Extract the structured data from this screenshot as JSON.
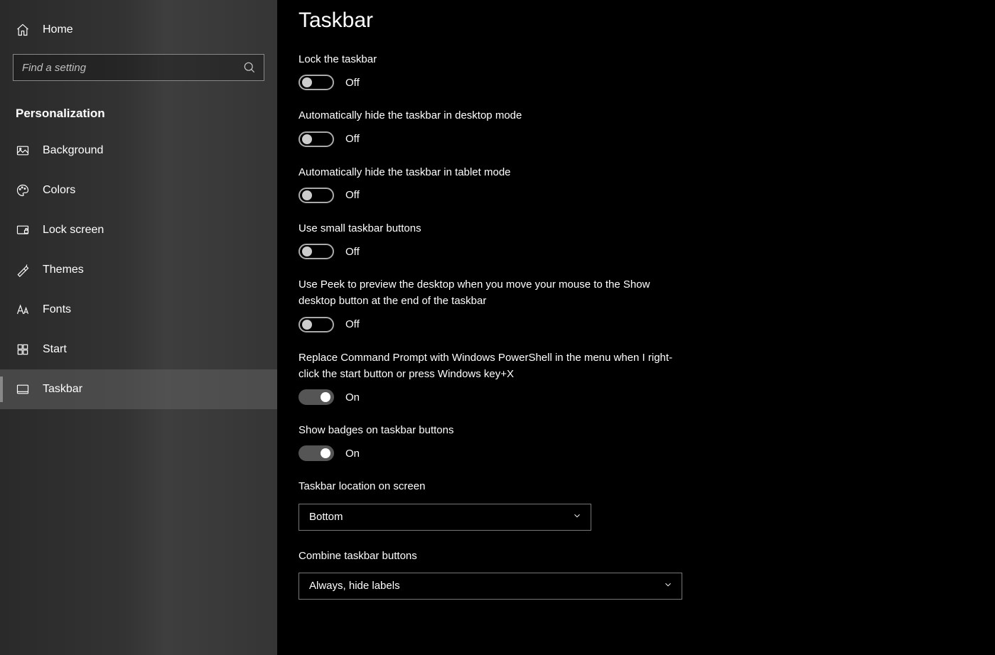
{
  "sidebar": {
    "home": "Home",
    "search_placeholder": "Find a setting",
    "section": "Personalization",
    "items": [
      {
        "label": "Background"
      },
      {
        "label": "Colors"
      },
      {
        "label": "Lock screen"
      },
      {
        "label": "Themes"
      },
      {
        "label": "Fonts"
      },
      {
        "label": "Start"
      },
      {
        "label": "Taskbar"
      }
    ]
  },
  "page": {
    "title": "Taskbar",
    "off": "Off",
    "on": "On",
    "settings": [
      {
        "label": "Lock the taskbar",
        "state": "off"
      },
      {
        "label": "Automatically hide the taskbar in desktop mode",
        "state": "off"
      },
      {
        "label": "Automatically hide the taskbar in tablet mode",
        "state": "off"
      },
      {
        "label": "Use small taskbar buttons",
        "state": "off"
      },
      {
        "label": "Use Peek to preview the desktop when you move your mouse to the Show desktop button at the end of the taskbar",
        "state": "off"
      },
      {
        "label": "Replace Command Prompt with Windows PowerShell in the menu when I right-click the start button or press Windows key+X",
        "state": "on"
      },
      {
        "label": "Show badges on taskbar buttons",
        "state": "on"
      }
    ],
    "location_label": "Taskbar location on screen",
    "location_value": "Bottom",
    "combine_label": "Combine taskbar buttons",
    "combine_value": "Always, hide labels"
  }
}
